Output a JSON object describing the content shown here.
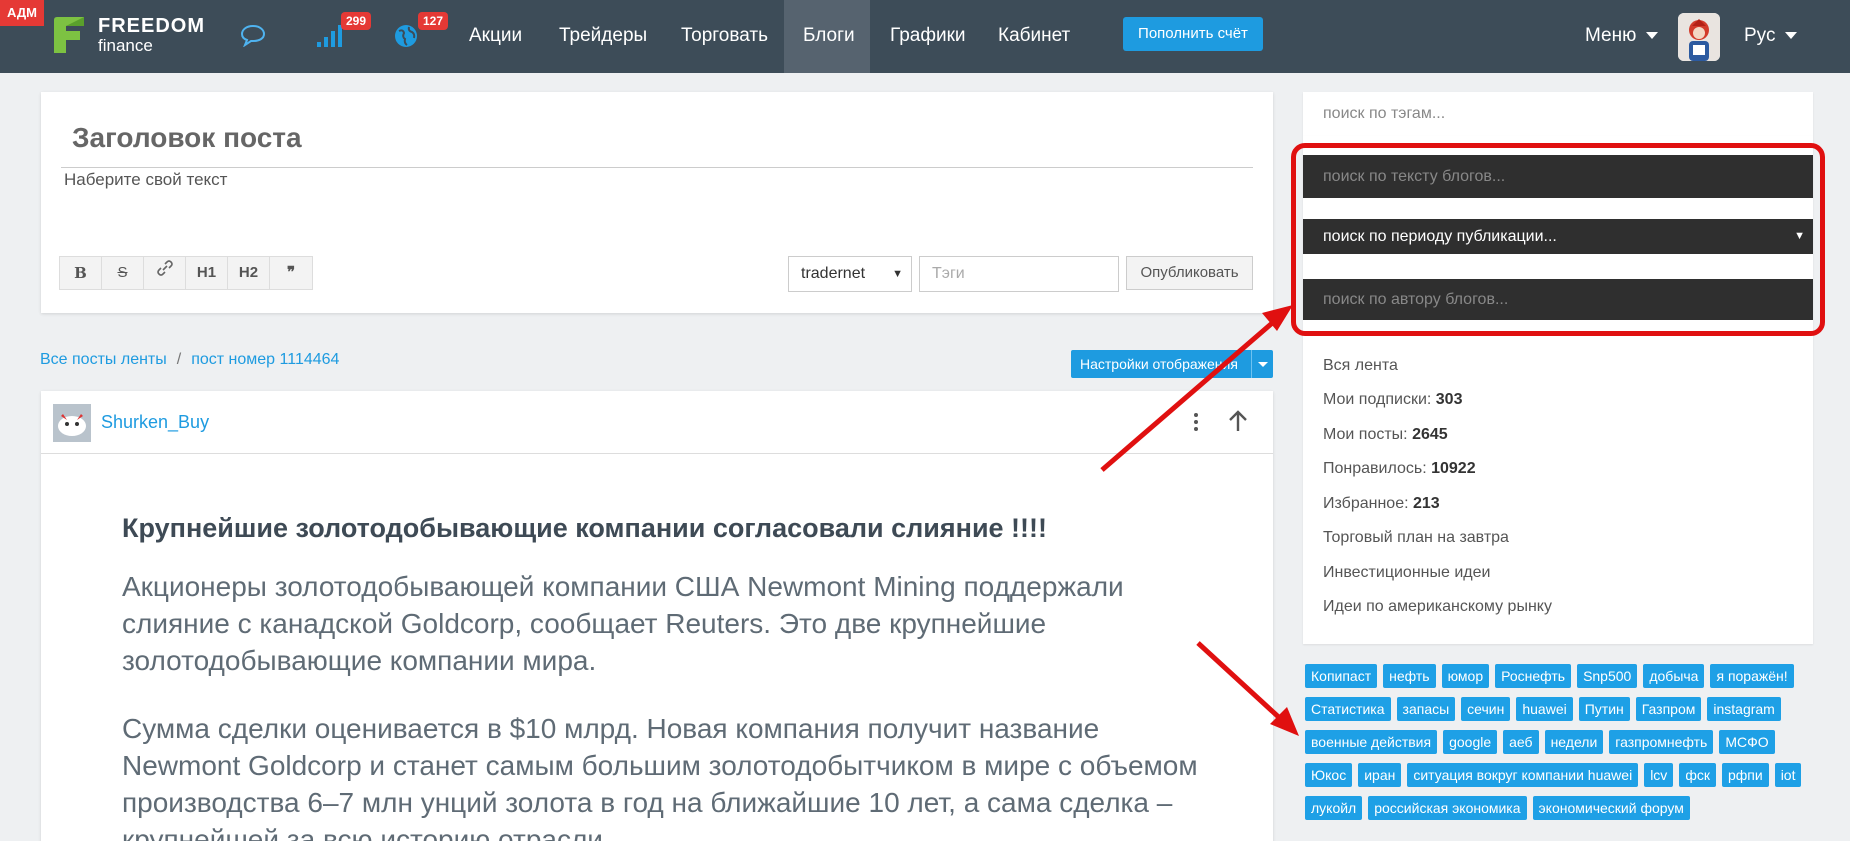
{
  "header": {
    "adm_badge": "АДМ",
    "logo_line1": "FREEDOM",
    "logo_line2": "finance",
    "signal_count": "299",
    "globe_count": "127",
    "nav": [
      "Акции",
      "Трейдеры",
      "Торговать",
      "Блоги",
      "Графики",
      "Кабинет"
    ],
    "active_nav": "Блоги",
    "topup_label": "Пополнить счёт",
    "menu_label": "Меню",
    "lang_label": "Рус"
  },
  "editor": {
    "title_placeholder": "Заголовок поста",
    "body_placeholder": "Наберите свой текст",
    "toolbar": [
      "B",
      "S",
      "🔗",
      "H1",
      "H2",
      "❞"
    ],
    "channel_select": "tradernet",
    "tags_placeholder": "Тэги",
    "publish_label": "Опубликовать"
  },
  "breadcrumb": {
    "all_posts": "Все посты ленты",
    "separator": "/",
    "current": "пост номер 1114464"
  },
  "settings_label": "Настройки отображения",
  "post": {
    "author": "Shurken_Buy",
    "title": "Крупнейшие золотодобывающие компании согласовали слияние !!!!",
    "paragraphs": [
      "Акционеры золотодобывающей компании США Newmont Mining поддержали слияние с канадской Goldcorp, сообщает Reuters. Это две крупнейшие золотодобывающие компании мира.",
      "Сумма сделки оценивается в $10 млрд. Новая компания получит название Newmont Goldcorp и станет самым большим золотодобытчиком в мире с объемом производства 6–7 млн унций золота в год на ближайшие 10 лет, а сама сделка – крупнейшей за всю историю отрасли."
    ]
  },
  "sidebar": {
    "tag_search_placeholder": "поиск по тэгам...",
    "text_search_placeholder": "поиск по тексту блогов...",
    "period_select": "поиск по периоду публикации...",
    "author_search_placeholder": "поиск по автору блогов...",
    "links": [
      {
        "label": "Вся лента",
        "value": ""
      },
      {
        "label": "Мои подписки: ",
        "value": "303"
      },
      {
        "label": "Мои посты: ",
        "value": "2645"
      },
      {
        "label": "Понравилось: ",
        "value": "10922"
      },
      {
        "label": "Избранное: ",
        "value": "213"
      },
      {
        "label": "Торговый план на завтра",
        "value": ""
      },
      {
        "label": "Инвестиционные идеи",
        "value": ""
      },
      {
        "label": "Идеи по американскому рынку",
        "value": ""
      }
    ],
    "tag_rows": [
      [
        "Копипаст",
        "нефть",
        "юмор",
        "Роснефть",
        "Snp500",
        "добыча",
        "я поражён!"
      ],
      [
        "Статистика",
        "запасы",
        "сечин",
        "huawei",
        "Путин",
        "Газпром",
        "instagram"
      ],
      [
        "военные действия",
        "google",
        "аеб",
        "недели",
        "газпромнефть",
        "МСФО"
      ],
      [
        "Юкос",
        "иран",
        "ситуация вокруг компании huawei",
        "lcv",
        "фск",
        "рфпи",
        "iot"
      ],
      [
        "лукойл",
        "российская экономика",
        "экономический форум"
      ]
    ]
  },
  "colors": {
    "topbar": "#3d4c58",
    "accent": "#1e9be0",
    "annotation": "#e01010",
    "badge": "#e53935"
  }
}
